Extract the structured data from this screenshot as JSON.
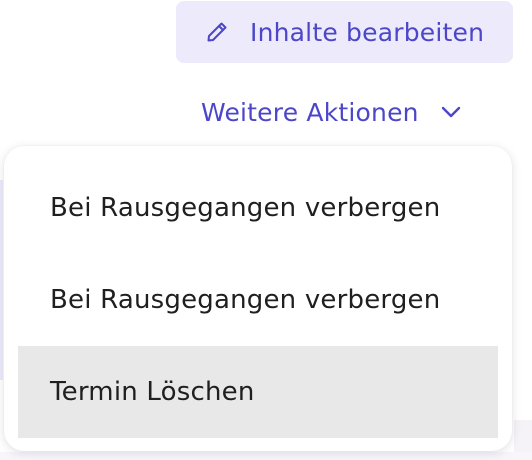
{
  "header": {
    "edit_button": {
      "label": "Inhalte bearbeiten",
      "icon": "pencil-icon"
    },
    "more_actions": {
      "label": "Weitere Aktionen",
      "icon": "chevron-down-icon"
    }
  },
  "menu": {
    "items": [
      {
        "label": "Bei Rausgegangen verbergen"
      },
      {
        "label": "Bei Rausgegangen verbergen"
      },
      {
        "label": "Termin Löschen",
        "highlighted": true
      }
    ]
  },
  "colors": {
    "accent": "#4d46c9",
    "accent_bg": "#eceafb",
    "menu_text": "#1f1f1f",
    "highlight_bg": "#e8e8e8"
  }
}
